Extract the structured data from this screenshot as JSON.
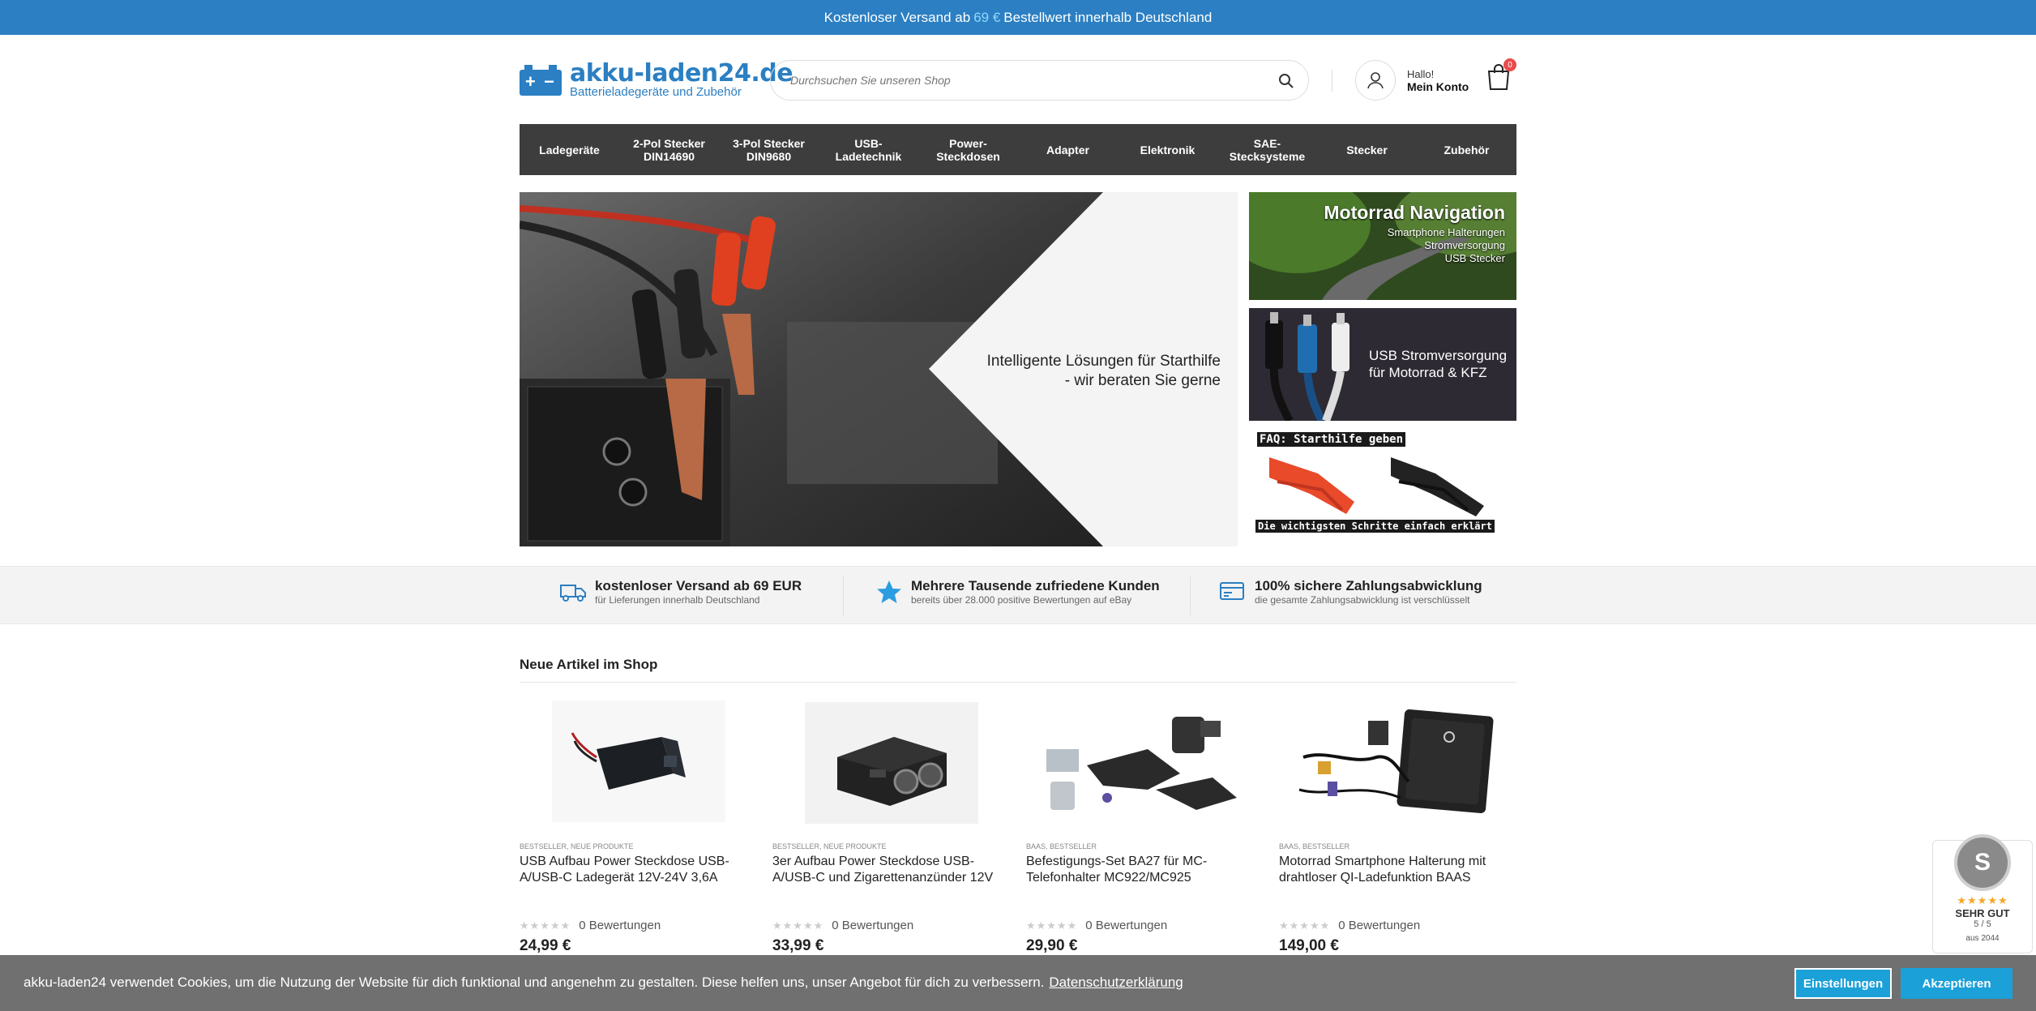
{
  "topbar": {
    "pre": "Kostenloser Versand ab",
    "amount": "69 €",
    "post": "Bestellwert innerhalb Deutschland"
  },
  "header": {
    "logo_name": "akku-laden24.de",
    "logo_tagline": "Batterieladegeräte und Zubehör",
    "search_placeholder": "Durchsuchen Sie unseren Shop",
    "account_hello": "Hallo!",
    "account_label": "Mein Konto",
    "cart_count": "0"
  },
  "nav": [
    "Ladegeräte",
    "2-Pol Stecker DIN14690",
    "3-Pol Stecker DIN9680",
    "USB-Ladetechnik",
    "Power-Steckdosen",
    "Adapter",
    "Elektronik",
    "SAE-Stecksysteme",
    "Stecker",
    "Zubehör"
  ],
  "hero": {
    "caption_line1": "Intelligente Lösungen für Starthilfe",
    "caption_line2": "- wir beraten Sie gerne"
  },
  "side_banners": {
    "nav_title": "Motorrad Navigation",
    "nav_sub1": "Smartphone Halterungen",
    "nav_sub2": "Stromversorgung",
    "nav_sub3": "USB Stecker",
    "usb_line1": "USB Stromversorgung",
    "usb_line2": "für Motorrad & KFZ",
    "faq_title": "FAQ: Starthilfe geben",
    "faq_sub": "Die wichtigsten Schritte einfach erklärt"
  },
  "features": [
    {
      "icon": "truck-icon",
      "title": "kostenloser Versand ab 69 EUR",
      "sub": "für Lieferungen innerhalb Deutschland"
    },
    {
      "icon": "star-icon",
      "title": "Mehrere Tausende zufriedene Kunden",
      "sub": "bereits über 28.000 positive Bewertungen auf eBay"
    },
    {
      "icon": "secure-payment-icon",
      "title": "100% sichere Zahlungsabwicklung",
      "sub": "die gesamte Zahlungsabwicklung ist verschlüsselt"
    }
  ],
  "section_title": "Neue Artikel im Shop",
  "products": [
    {
      "cats": "BESTSELLER, NEUE PRODUKTE",
      "title": "USB Aufbau Power Steckdose USB-A/USB-C Ladegerät 12V-24V 3,6A",
      "rating": "0 Bewertungen",
      "price": "24,99 €"
    },
    {
      "cats": "BESTSELLER, NEUE PRODUKTE",
      "title": "3er Aufbau Power Steckdose USB-A/USB-C und Zigarettenanzünder 12V",
      "rating": "0 Bewertungen",
      "price": "33,99 €"
    },
    {
      "cats": "BAAS, BESTSELLER",
      "title": "Befestigungs-Set BA27 für MC-Telefonhalter MC922/MC925",
      "rating": "0 Bewertungen",
      "price": "29,90 €"
    },
    {
      "cats": "BAAS, BESTSELLER",
      "title": "Motorrad Smartphone Halterung mit drahtloser QI-Ladefunktion BAAS",
      "rating": "0 Bewertungen",
      "price": "149,00 €"
    }
  ],
  "trust_badge": {
    "grade": "SEHR GUT",
    "score": "5 / 5",
    "count": "aus 2044"
  },
  "cookie": {
    "text": "akku-laden24 verwendet Cookies, um die Nutzung der Website für dich funktional und angenehm zu gestalten. Diese helfen uns, unser Angebot für dich zu verbessern.",
    "link": "Datenschutzerklärung",
    "settings": "Einstellungen",
    "accept": "Akzeptieren"
  },
  "colors": {
    "brand": "#2b7fc2",
    "nav_bg": "#3d3d3d",
    "accept": "#1ba0d8"
  }
}
